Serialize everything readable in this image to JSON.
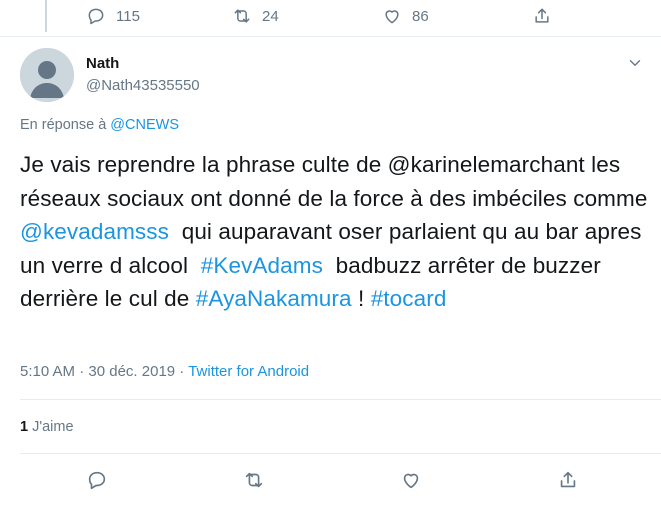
{
  "previous_tweet": {
    "reply_count": "115",
    "retweet_count": "24",
    "like_count": "86"
  },
  "tweet": {
    "author_name": "Nath",
    "author_handle": "@Nath43535550",
    "reply_prefix": "En réponse à ",
    "reply_target": "@CNEWS",
    "text_segments": [
      {
        "text": "Je vais reprendre la phrase culte de @karinelemarchant les réseaux sociaux ont donné de la force à des imbéciles comme ",
        "link": false
      },
      {
        "text": "@kevadamsss",
        "link": true
      },
      {
        "text": "  qui auparavant oser parlaient qu au bar apres un verre d alcool  ",
        "link": false
      },
      {
        "text": "#KevAdams",
        "link": true
      },
      {
        "text": "  badbuzz arrêter de buzzer derrière le cul de ",
        "link": false
      },
      {
        "text": "#AyaNakamura",
        "link": true
      },
      {
        "text": " ! ",
        "link": false
      },
      {
        "text": "#tocard",
        "link": true
      }
    ],
    "time": "5:10 AM",
    "separator": " · ",
    "date": "30 déc. 2019",
    "source": "Twitter for Android",
    "likes_count": "1",
    "likes_label": "J'aime"
  },
  "icons": {
    "reply": "reply-icon",
    "retweet": "retweet-icon",
    "like": "heart-icon",
    "share": "share-icon",
    "more": "chevron-down-icon"
  },
  "colors": {
    "link": "#1b95e0",
    "secondary_text": "#657786",
    "divider": "#e6ecf0"
  }
}
